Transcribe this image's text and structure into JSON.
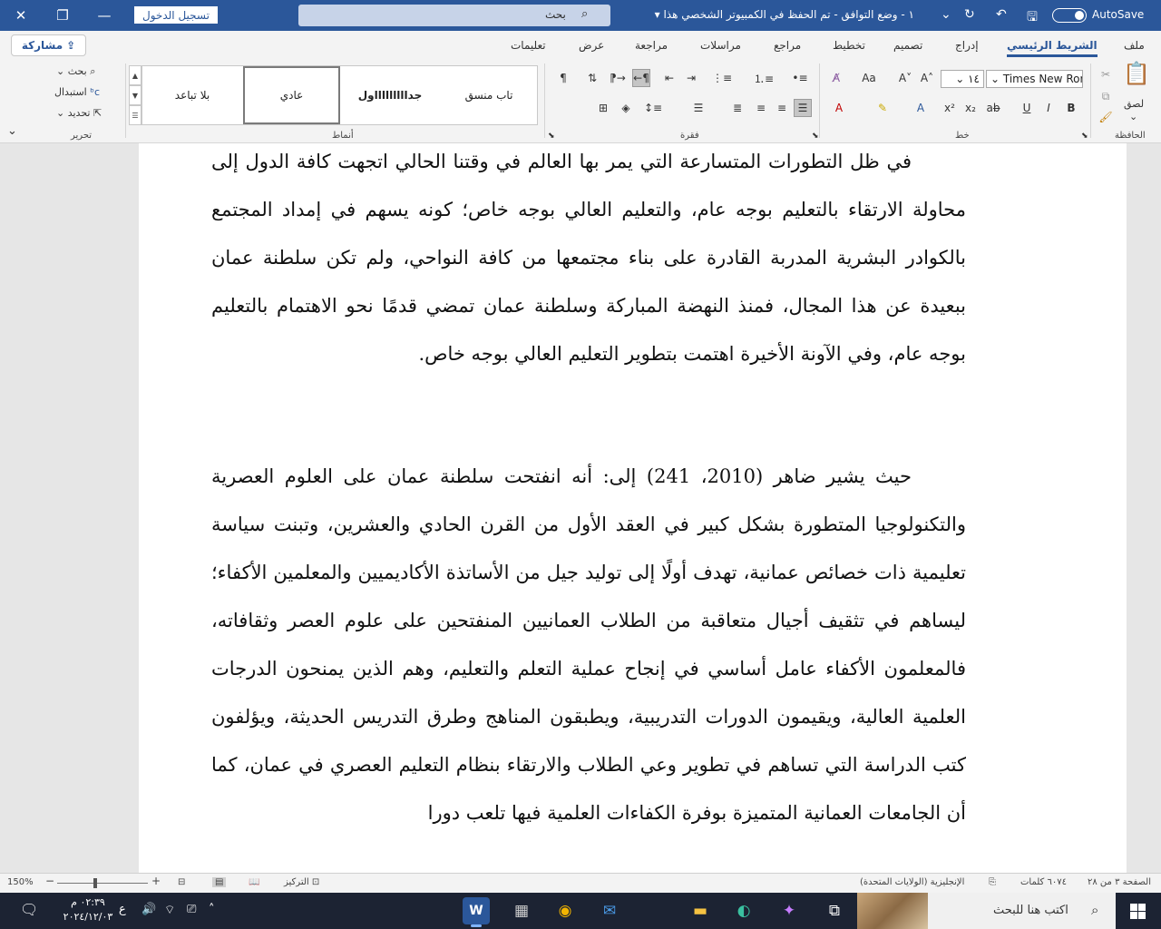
{
  "titlebar": {
    "doc_title": "١ - وضع التوافق - تم الحفظ في الكمبيوتر الشخصي هذا ▾",
    "search_text": "بحث",
    "signin_label": "تسجيل الدخول",
    "autosave_label": "AutoSave",
    "autosave_on": true,
    "bg_color": "#2b579a"
  },
  "share_label": "مشاركة",
  "tabs": [
    "ملف",
    "الشريط الرئيسي",
    "إدراج",
    "تصميم",
    "تخطيط",
    "مراجع",
    "مراسلات",
    "مراجعة",
    "عرض",
    "تعليمات"
  ],
  "active_tab": "الشريط الرئيسي",
  "ribbon": {
    "clipboard": {
      "label": "الحافظة",
      "paste": "لصق"
    },
    "font": {
      "label": "خط",
      "name": "Times New Rom",
      "size": "١٤"
    },
    "paragraph": {
      "label": "فقرة"
    },
    "styles": {
      "label": "أنماط",
      "items": [
        "تاب منسق",
        "جداااااااااول",
        "عادي",
        "بلا تباعد"
      ],
      "selected": "عادي"
    },
    "editing": {
      "label": "تحرير",
      "find": "بحث",
      "replace": "استبدال",
      "select": "تحديد"
    }
  },
  "document": {
    "paragraphs": [
      "في ظل التطورات المتسارعة التي يمر بها العالم في وقتنا الحالي اتجهت كافة الدول إلى محاولة الارتقاء بالتعليم بوجه عام، والتعليم العالي بوجه خاص؛ كونه يسهم في إمداد المجتمع بالكوادر البشرية المدربة القادرة على بناء مجتمعها من كافة النواحي، ولم تكن سلطنة عمان ببعيدة عن هذا المجال، فمنذ النهضة المباركة وسلطنة عمان تمضي قدمًا نحو الاهتمام بالتعليم بوجه عام، وفي الآونة الأخيرة اهتمت بتطوير التعليم العالي بوجه خاص.",
      "حيث يشير ضاهر (2010، 241) إلى: أنه انفتحت سلطنة عمان على العلوم العصرية والتكنولوجيا المتطورة بشكل كبير في العقد الأول من القرن الحادي والعشرين، وتبنت سياسة تعليمية ذات خصائص عمانية، تهدف أولًا إلى توليد جيل من الأساتذة الأكاديميين والمعلمين الأكفاء؛ ليساهم في تثقيف أجيال متعاقبة من الطلاب العمانيين المنفتحين على علوم العصر وثقافاته، فالمعلمون الأكفاء عامل أساسي في إنجاح عملية التعلم والتعليم، وهم الذين يمنحون الدرجات العلمية العالية، ويقيمون الدورات التدريبية، ويطبقون المناهج وطرق التدريس الحديثة، ويؤلفون كتب الدراسة التي تساهم في تطوير وعي الطلاب والارتقاء بنظام التعليم العصري في عمان، كما أن الجامعات العمانية المتميزة بوفرة الكفاءات العلمية فيها تلعب دورا"
    ]
  },
  "status": {
    "page": "الصفحة ٣ من ٢٨",
    "words": "٦٠٧٤ كلمات",
    "language": "الإنجليزية (الولايات المتحدة)",
    "focus": "التركيز",
    "zoom": "150%"
  },
  "taskbar": {
    "search_placeholder": "اكتب هنا للبحث",
    "time": "٠٢:٣٩ م",
    "date": "٢٠٢٤/١٢/٠٣",
    "lang": "ع",
    "apps": [
      "file-explorer-app",
      "edge-app",
      "copilot-app",
      "mail-app",
      "chrome-app",
      "calculator-app",
      "word-app"
    ]
  }
}
